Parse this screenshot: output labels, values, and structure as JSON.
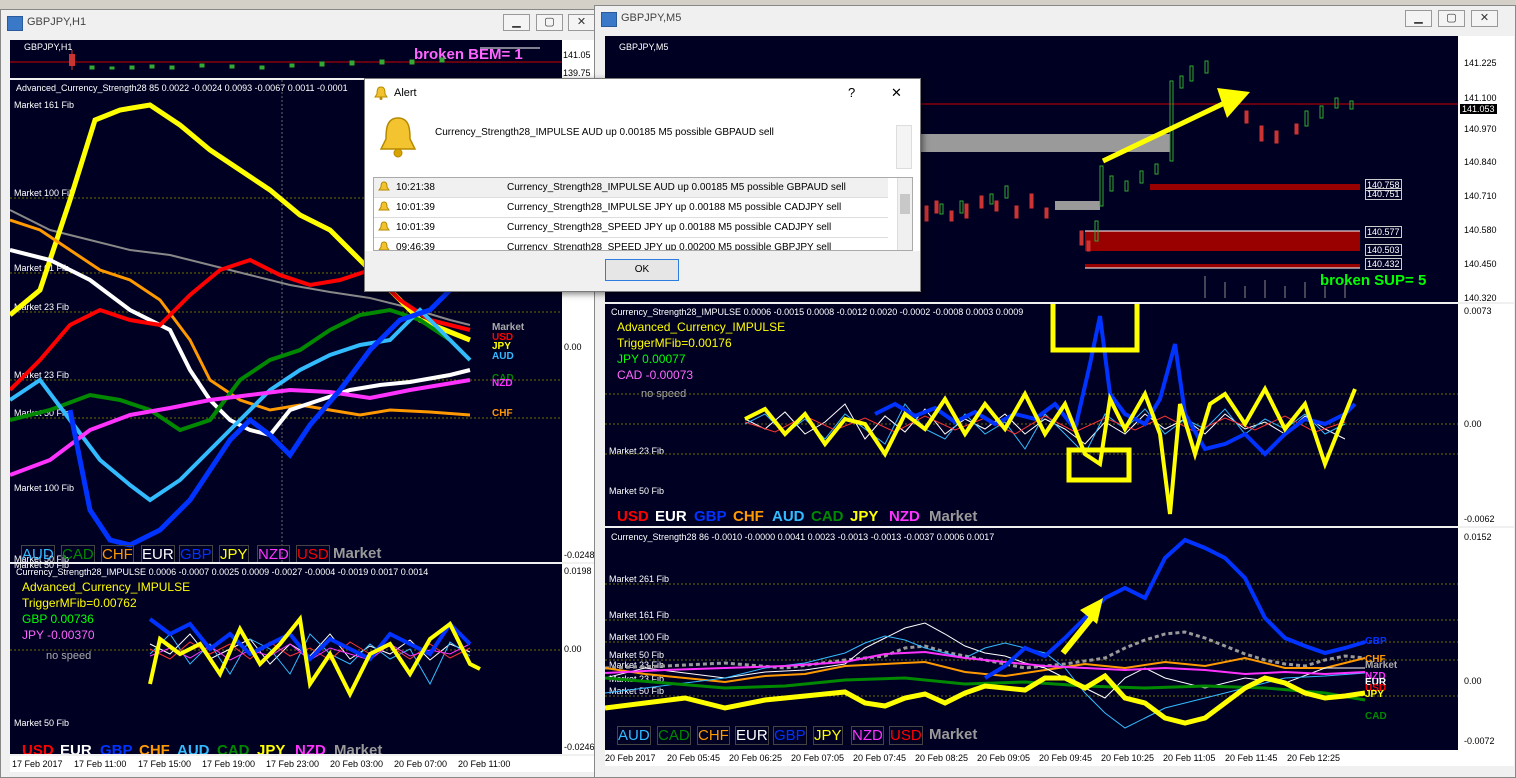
{
  "left_window": {
    "title": "GBPJPY,H1",
    "price_chart": {
      "symbol": "GBPJPY,H1",
      "price_high": "141.05",
      "price_low": "139.75",
      "label": "broken BEM= 1"
    },
    "strength_panel": {
      "header": "Advanced_Currency_Strength28 85 0.0022 -0.0024 0.0093 -0.0067 0.0011 -0.0001",
      "fib_labels": [
        "Market 161 Fib",
        "Market 100 Fib",
        "Market 61 Fib",
        "Market 23 Fib",
        "Market 23 Fib",
        "Market 50 Fib",
        "Market 100 Fib",
        "Market 50 Fib"
      ],
      "right_axis": [
        "0.00",
        "-0.0248"
      ],
      "tags": [
        "Market",
        "USD",
        "JPY",
        "AUD",
        "CAD",
        "NZD",
        "CHF"
      ],
      "legend": [
        "AUD",
        "CAD",
        "CHF",
        "EUR",
        "GBP",
        "JPY",
        "NZD",
        "USD",
        "Market"
      ]
    },
    "impulse_panel": {
      "header": "Currency_Strength28_IMPULSE 0.0006 -0.0007 0.0025 0.0009 -0.0027 -0.0004 -0.0019 0.0017 0.0014",
      "name": "Advanced_Currency_IMPULSE",
      "trigger": "TriggerMFib=0.00762",
      "line1": "GBP 0.00736",
      "line2": "JPY -0.00370",
      "note": "no speed",
      "fib_label": "Market 50 Fib",
      "right_axis": [
        "0.0198",
        "0.00",
        "-0.0246"
      ],
      "legend": [
        "USD",
        "EUR",
        "GBP",
        "CHF",
        "AUD",
        "CAD",
        "JPY",
        "NZD",
        "Market"
      ]
    },
    "time_axis": [
      "17 Feb 2017",
      "17 Feb 11:00",
      "17 Feb 15:00",
      "17 Feb 19:00",
      "17 Feb 23:00",
      "20 Feb 03:00",
      "20 Feb 07:00",
      "20 Feb 11:00"
    ]
  },
  "right_window": {
    "title": "GBPJPY,M5",
    "price_chart": {
      "symbol": "GBPJPY,M5",
      "price_axis": [
        "141.225",
        "141.100",
        "140.970",
        "140.840",
        "140.710",
        "140.580",
        "140.450",
        "140.320"
      ],
      "current_price": "141.053",
      "level_tags": [
        "140.758",
        "140.751",
        "140.577",
        "140.503",
        "140.432"
      ],
      "label": "broken SUP= 5"
    },
    "impulse_panel": {
      "header": "Currency_Strength28_IMPULSE 0.0006 -0.0015 0.0008 -0.0012 0.0020 -0.0002 -0.0008 0.0003 0.0009",
      "name": "Advanced_Currency_IMPULSE",
      "trigger": "TriggerMFib=0.00176",
      "line1": "JPY 0.00077",
      "line2": "CAD -0.00073",
      "note": "no speed",
      "fib_labels": [
        "Market 23 Fib",
        "Market 50 Fib"
      ],
      "right_axis": [
        "0.0073",
        "0.00",
        "-0.0062"
      ],
      "legend": [
        "USD",
        "EUR",
        "GBP",
        "CHF",
        "AUD",
        "CAD",
        "JPY",
        "NZD",
        "Market"
      ]
    },
    "strength_panel": {
      "header": "Currency_Strength28 86 -0.0010 -0.0000 0.0041 0.0023 -0.0013 -0.0013 -0.0037 0.0006 0.0017",
      "fib_labels": [
        "Market 261 Fib",
        "Market 161 Fib",
        "Market 100 Fib",
        "Market 50 Fib",
        "Market 23 Fib",
        "Market 23 Fib",
        "Market 50 Fib"
      ],
      "right_axis": [
        "0.0152",
        "0.00",
        "-0.0072"
      ],
      "tags": [
        "GBP",
        "CHF",
        "Market",
        "NZD",
        "EUR",
        "USD",
        "JPY",
        "CAD"
      ],
      "legend": [
        "AUD",
        "CAD",
        "CHF",
        "EUR",
        "GBP",
        "JPY",
        "NZD",
        "USD",
        "Market"
      ]
    },
    "time_axis": [
      "20 Feb 2017",
      "20 Feb 05:45",
      "20 Feb 06:25",
      "20 Feb 07:05",
      "20 Feb 07:45",
      "20 Feb 08:25",
      "20 Feb 09:05",
      "20 Feb 09:45",
      "20 Feb 10:25",
      "20 Feb 11:05",
      "20 Feb 11:45",
      "20 Feb 12:25"
    ]
  },
  "alert": {
    "title": "Alert",
    "help": "?",
    "close": "✕",
    "message": "Currency_Strength28_IMPULSE AUD up 0.00185 M5 possible GBPAUD sell",
    "rows": [
      {
        "time": "10:21:38",
        "text": "Currency_Strength28_IMPULSE AUD up 0.00185 M5 possible GBPAUD sell"
      },
      {
        "time": "10:01:39",
        "text": "Currency_Strength28_IMPULSE JPY up 0.00188 M5 possible CADJPY sell"
      },
      {
        "time": "10:01:39",
        "text": "Currency_Strength28_SPEED JPY up 0.00188 M5 possible CADJPY sell"
      },
      {
        "time": "09:46:39",
        "text": "Currency_Strength28_SPEED JPY up 0.00200 M5 possible GBPJPY sell"
      }
    ],
    "ok": "OK"
  },
  "colors": {
    "AUD": "#33bbff",
    "CAD": "#008800",
    "CHF": "#ff9900",
    "EUR": "#ffffff",
    "GBP": "#0033ff",
    "JPY": "#ffff00",
    "NZD": "#ff33ff",
    "USD": "#ff0000",
    "Market": "#999999",
    "background": "#000022"
  }
}
